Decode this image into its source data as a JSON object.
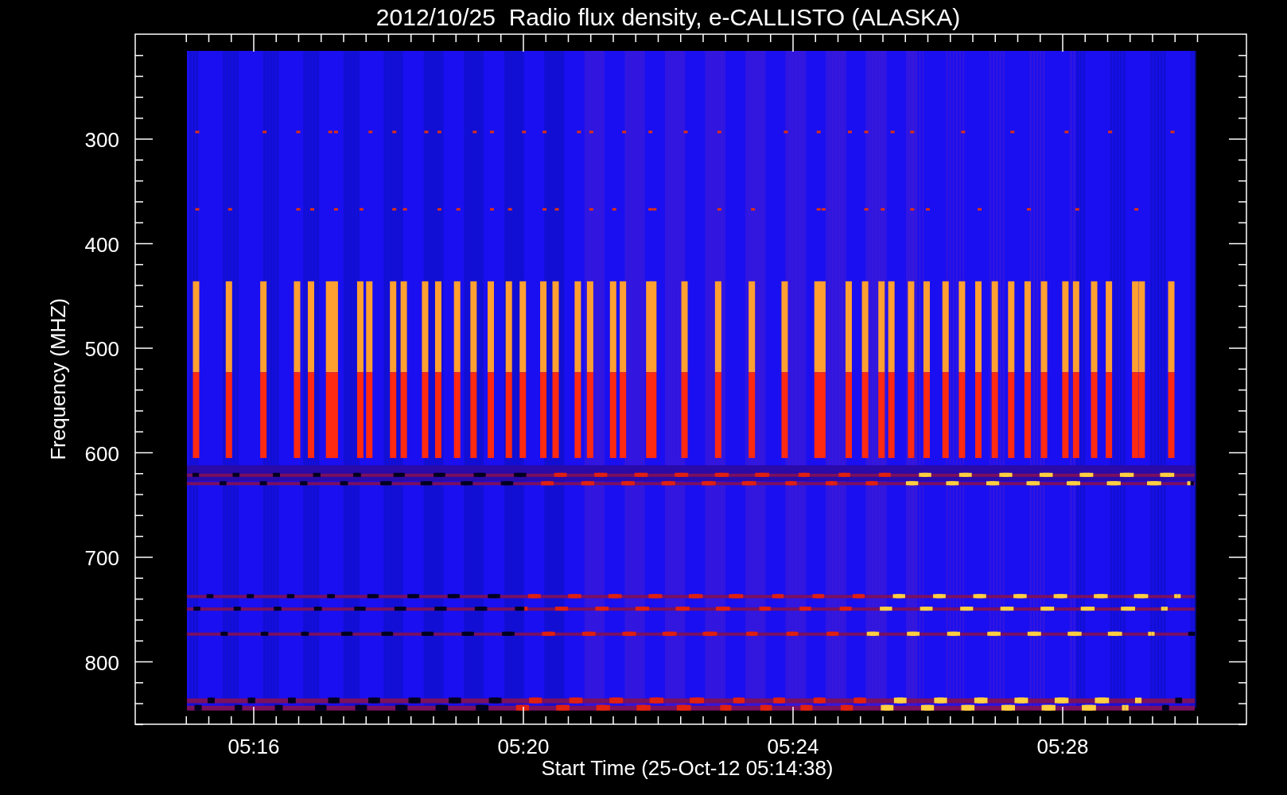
{
  "title": "2012/10/25  Radio flux density, e-CALLISTO (ALASKA)",
  "y_axis": {
    "label": "Frequency (MHZ)",
    "ticks": [
      "300",
      "400",
      "500",
      "600",
      "700",
      "800"
    ]
  },
  "x_axis": {
    "label": "Start Time (25-Oct-12 05:14:38)",
    "ticks": [
      "05:16",
      "05:20",
      "05:24",
      "05:28"
    ]
  }
}
